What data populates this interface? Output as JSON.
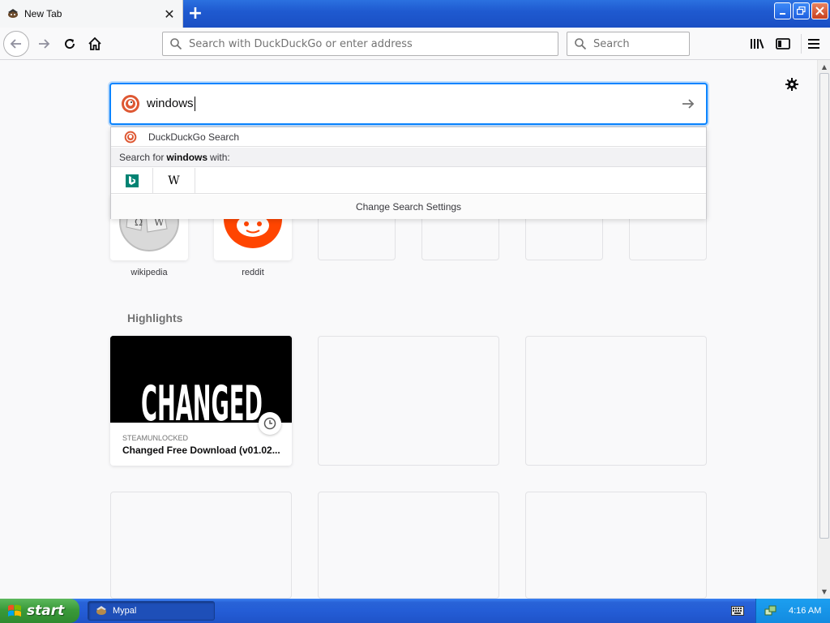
{
  "browser": {
    "tab_title": "New Tab",
    "url_placeholder": "Search with DuckDuckGo or enter address",
    "search_placeholder": "Search"
  },
  "newtab": {
    "search_value": "windows",
    "dropdown": {
      "engine_suggestion": "DuckDuckGo Search",
      "search_for_prefix": "Search for",
      "search_term": "windows",
      "search_for_suffix": "with:",
      "engines": [
        "bing-icon",
        "wikipedia-icon"
      ],
      "change_settings": "Change Search Settings"
    },
    "top_sites": [
      {
        "label": "wikipedia"
      },
      {
        "label": "reddit"
      },
      {
        "label": ""
      },
      {
        "label": ""
      },
      {
        "label": ""
      },
      {
        "label": ""
      }
    ],
    "highlights_title": "Highlights",
    "highlight_card": {
      "image_text": "CHANGED",
      "source": "STEAMUNLOCKED",
      "title": "Changed Free Download (v01.02..."
    }
  },
  "taskbar": {
    "start_label": "start",
    "task_label": "Mypal",
    "clock": "4:16 AM"
  },
  "colors": {
    "accent": "#0a84ff",
    "xp_blue": "#245dd6",
    "start_green": "#3a9a3a",
    "reddit_orange": "#ff4500"
  }
}
